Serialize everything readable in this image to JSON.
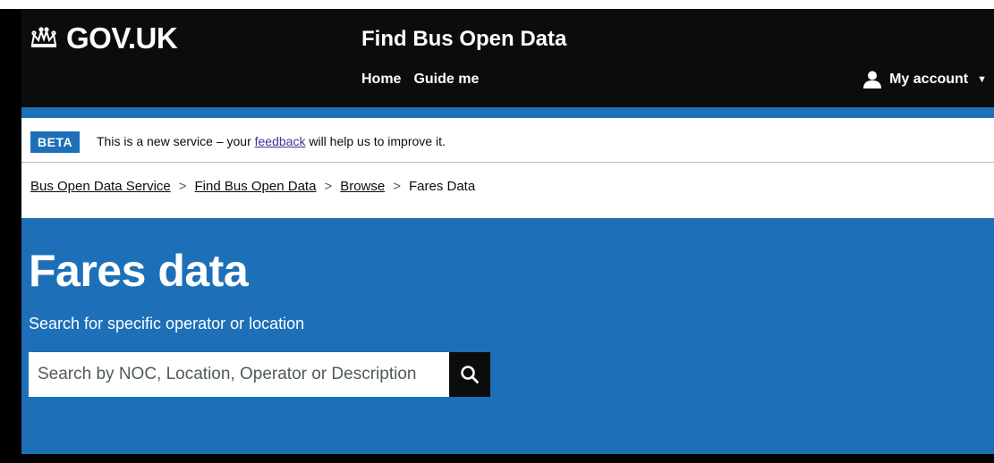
{
  "header": {
    "logo_text": "GOV.UK",
    "service_name": "Find Bus Open Data",
    "nav": [
      {
        "label": "Home"
      },
      {
        "label": "Guide me"
      }
    ],
    "account_label": "My account",
    "account_caret": "▼"
  },
  "beta": {
    "tag": "BETA",
    "text_before": "This is a new service – your ",
    "link": "feedback",
    "text_after": " will help us to improve it."
  },
  "breadcrumbs": {
    "items": [
      {
        "label": "Bus Open Data Service"
      },
      {
        "label": "Find Bus Open Data"
      },
      {
        "label": "Browse"
      }
    ],
    "separator": ">",
    "current": "Fares Data"
  },
  "hero": {
    "title": "Fares data",
    "subtitle": "Search for specific operator or location",
    "search_placeholder": "Search by NOC, Location, Operator or Description"
  },
  "colors": {
    "header_bg": "#0b0c0c",
    "brand_blue": "#1d70b8",
    "link_visited": "#4c2c92"
  }
}
